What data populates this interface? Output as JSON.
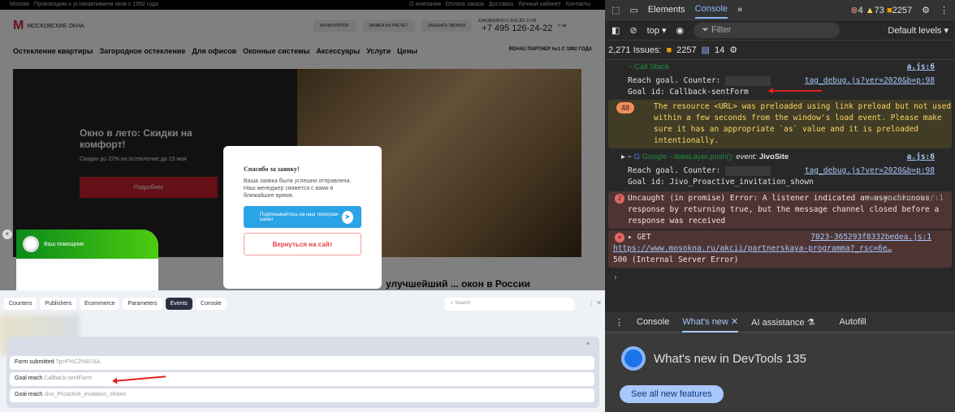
{
  "site": {
    "topbar_left": [
      "Москва",
      "Производим и устанавливаем окна с 1992 года"
    ],
    "topbar_right": [
      "О компании",
      "Оплата заказа",
      "Доставка",
      "Личный кабинет",
      "Контакты"
    ],
    "logo": "МОСКОВСКИЕ ОКНА",
    "header_buttons": [
      "КАЛЬКУЛЯТОР",
      "ЗАЯВКА НА РАСЧЕТ",
      "ЗАКАЗАТЬ ЗВОНОК"
    ],
    "hours": "ЕЖЕДНЕВНО С 9:00 ДО 21:00",
    "phone": "+7 495 126-24-22",
    "nav": [
      "Остекление квартиры",
      "Загородное остекление",
      "Для офисов",
      "Оконные системы",
      "Аксессуары",
      "Услуги",
      "Цены"
    ],
    "partner": "REHAU ПАРТНЕР №1 С 1992 ГОДА",
    "hero_title": "Окно в лето: Скидки на комфорт!",
    "hero_text": "Скидки до 22% на остекление до 15 мая",
    "hero_button": "Подробнее",
    "below_heading": "улучшейший ... окон в России",
    "modal": {
      "title": "Спасибо за заявку!",
      "text1": "Ваша заявка была успешно отправлена.",
      "text2": "Наш менеджер свяжется с вами в ближайшее время.",
      "telegram": "Подписывайтесь на наш телеграм-канал",
      "back": "Вернуться на сайт"
    },
    "chat_title": "Ваш помощник"
  },
  "panel": {
    "tabs": [
      "Counters",
      "Publishers",
      "Ecommerce",
      "Parameters",
      "Events",
      "Console"
    ],
    "active_tab": "Events",
    "search_placeholder": "Search",
    "events": [
      {
        "type": "Form submitted",
        "value": "?p=F%C2%87AA"
      },
      {
        "type": "Goal reach",
        "value": "Callback-sentForm"
      },
      {
        "type": "Goal reach",
        "value": "Jivo_Proactive_invitation_shown"
      }
    ]
  },
  "devtools": {
    "tabs": [
      "Elements",
      "Console"
    ],
    "errors": "4",
    "warnings": "73",
    "issues": "2257",
    "context": "top",
    "filter_placeholder": "Filter",
    "levels": "Default levels",
    "issues_label": "2,271 Issues:",
    "issues_count": "2257",
    "info_count": "14",
    "messages": {
      "callstack": "~ Call Stack",
      "src1": "a.js:6",
      "reach1": "Reach goal. Counter:",
      "tag1": "tag_debug.js?ver=2020&b=p:98",
      "goal1": "Goal id: Callback-sentForm",
      "warn_count": "48",
      "warn_text": "The resource <URL> was preloaded using link preload but not used within a few seconds from the window's load event. Please make sure it has an appropriate `as` value and it is preloaded intentionally.",
      "google": "Google - dataLayer.push():",
      "event": "event:",
      "event_val": "JivoSite",
      "src2": "a.js:6",
      "reach2": "Reach goal. Counter:",
      "tag2": "tag_debug.js?ver=2020&b=p:98",
      "goal2": "Goal id: Jivo_Proactive_invitation_shown",
      "err_count": "2",
      "err_text": "Uncaught (in promise) Error: A listener indicated an asynchronous response by returning true, but the message channel closed before a response was received",
      "err_src": "www.mosokna.ru/:1",
      "get": "GET",
      "get_src": "7023-365293f8332bedea.js:1",
      "get_url": "https://www.mosokna.ru/akcii/partnerskaya-programma?_rsc=6e…",
      "get_status": "500 (Internal Server Error)"
    },
    "drawer_tabs": [
      "Console",
      "What's new",
      "AI assistance",
      "Autofill"
    ],
    "whats_new": "What's new in DevTools 135",
    "see_all": "See all new features"
  }
}
